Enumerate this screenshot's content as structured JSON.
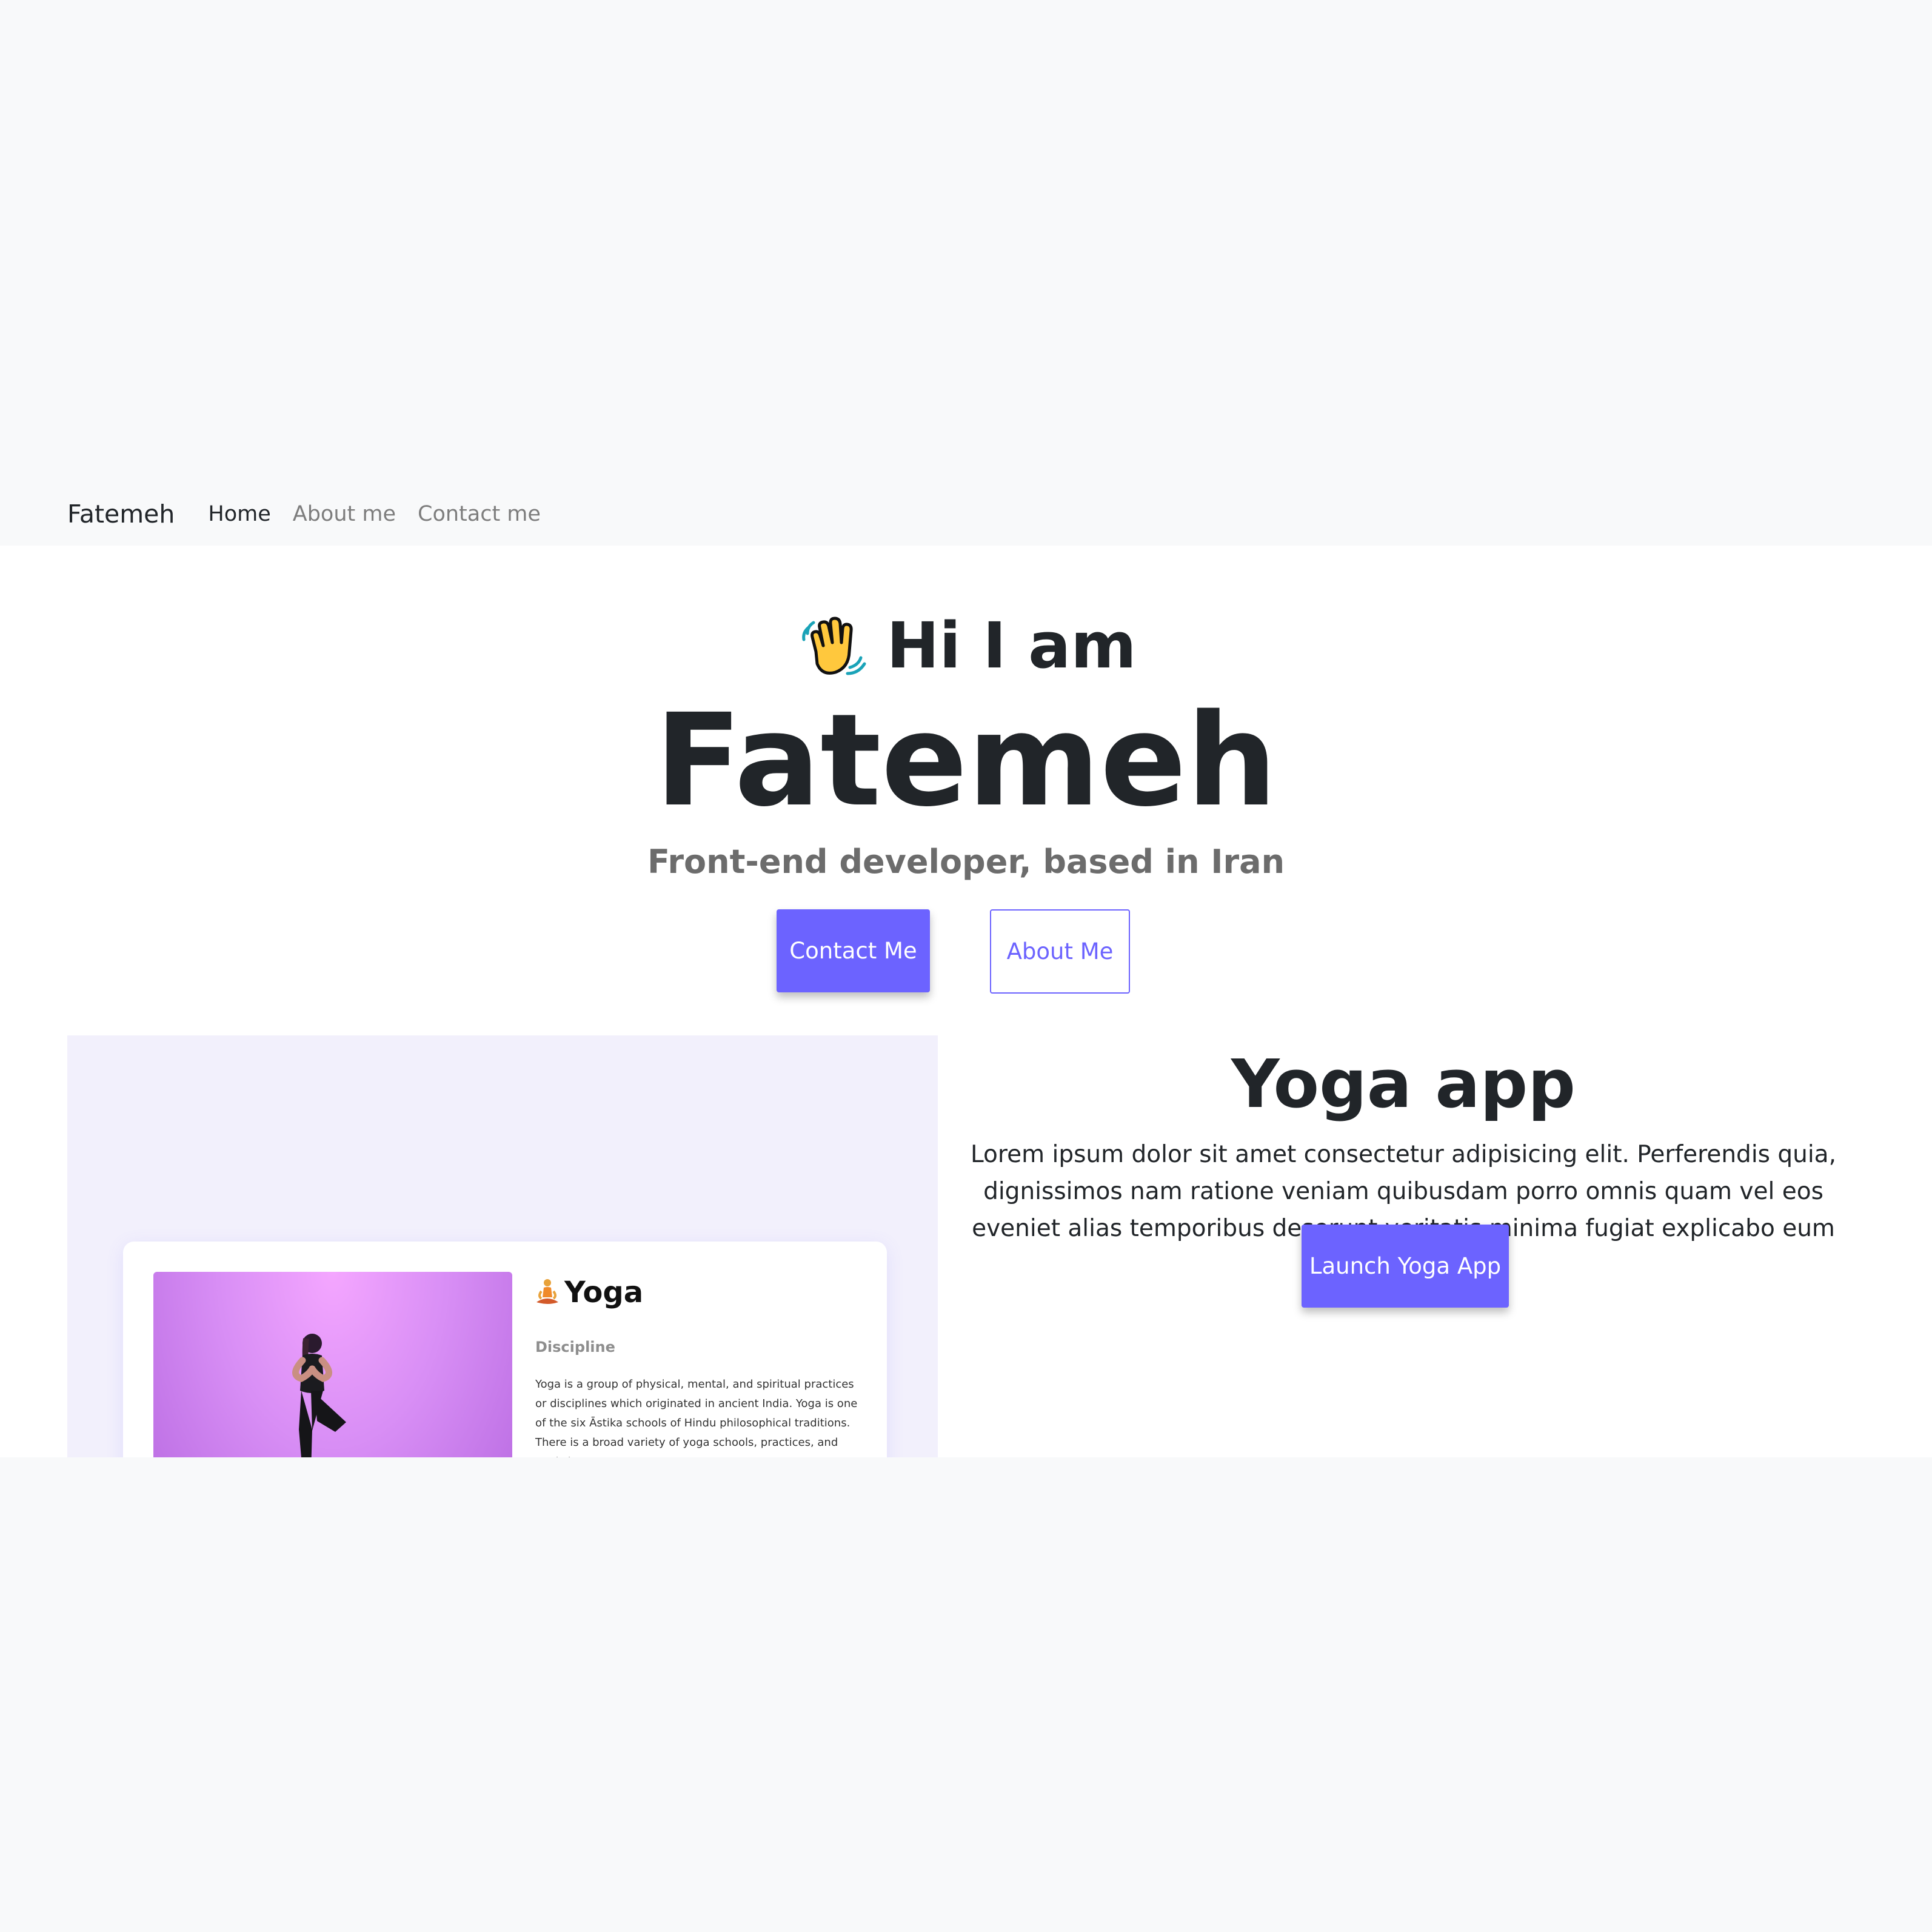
{
  "navbar": {
    "brand": "Fatemeh",
    "links": [
      {
        "label": "Home"
      },
      {
        "label": "About me"
      },
      {
        "label": "Contact me"
      }
    ]
  },
  "hero": {
    "greeting": "Hi I am",
    "name": "Fatemeh",
    "tagline": "Front-end developer, based in Iran",
    "contact_button": "Contact Me",
    "about_button": "About Me",
    "wave_icon": "waving-hand-icon"
  },
  "project": {
    "title": "Yoga app",
    "description": "Lorem ipsum dolor sit amet consectetur adipisicing elit. Perferendis quia, dignissimos nam ratione veniam quibusdam porro omnis quam vel eos eveniet alias temporibus deserunt veritatis minima fugiat explicabo eum dolore.",
    "launch_button": "Launch Yoga App",
    "preview": {
      "card_title": "Yoga",
      "card_subtitle": "Discipline",
      "card_text": "Yoga is a group of physical, mental, and spiritual practices or disciplines which originated in ancient India. Yoga is one of the six Āstika schools of Hindu philosophical traditions. There is a broad variety of yoga schools, practices, and goals in"
    }
  },
  "colors": {
    "accent": "#6c63ff",
    "page_background": "#f8f9fa",
    "preview_background": "#f2f0fc"
  }
}
